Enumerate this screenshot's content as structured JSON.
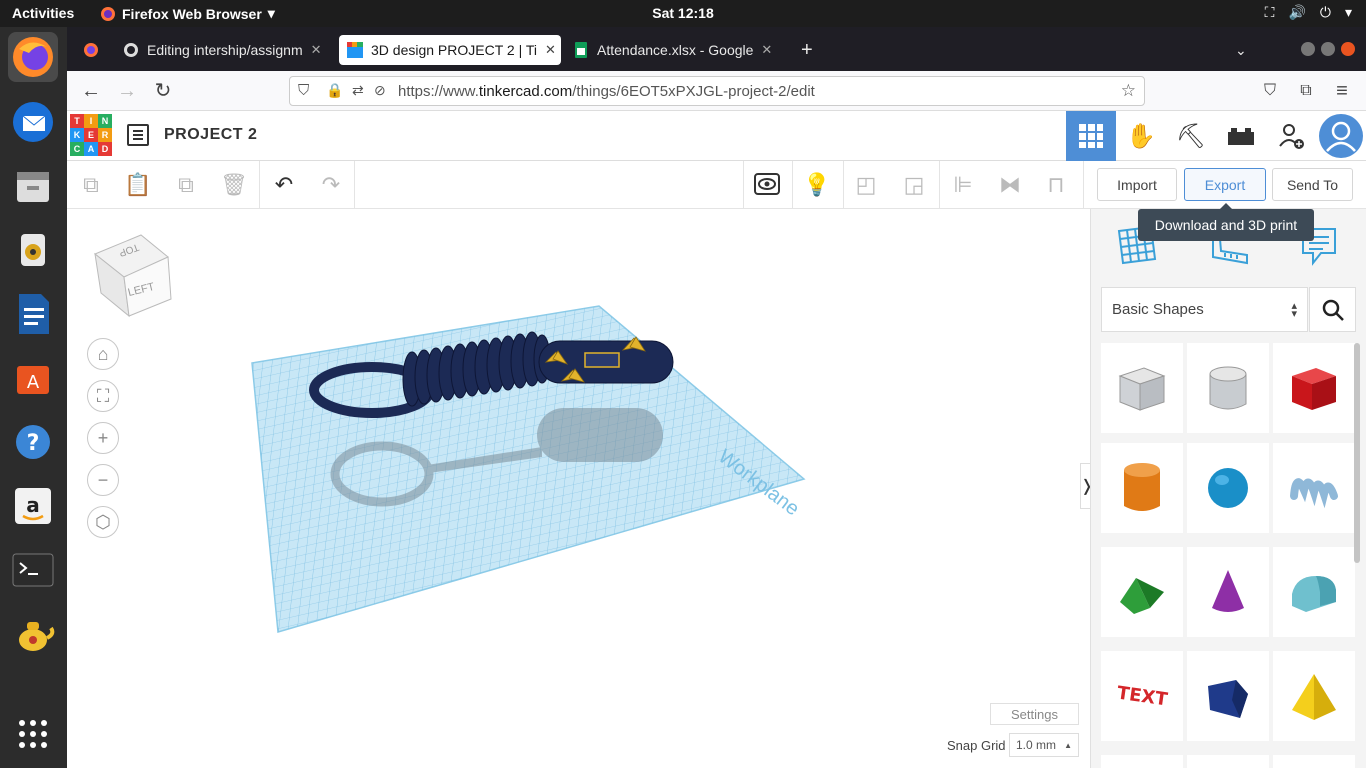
{
  "system": {
    "activities": "Activities",
    "app_name": "Firefox Web Browser",
    "clock": "Sat 12:18"
  },
  "browser": {
    "tabs": [
      {
        "title": "Editing intership/assignm",
        "icon": "github-icon"
      },
      {
        "title": "3D design PROJECT 2 | Ti",
        "icon": "tinkercad-icon",
        "selected": true
      },
      {
        "title": "Attendance.xlsx - Google",
        "icon": "sheets-icon"
      }
    ],
    "url_prefix": "https://www.",
    "url_domain": "tinkercad.com",
    "url_path": "/things/6EOT5xPXJGL-project-2/edit"
  },
  "tinkercad": {
    "logo_letters": [
      "T",
      "I",
      "N",
      "K",
      "E",
      "R",
      "C",
      "A",
      "D"
    ],
    "project_title": "PROJECT 2",
    "import_label": "Import",
    "export_label": "Export",
    "sendto_label": "Send To",
    "tooltip": "Download and 3D print",
    "shape_category": "Basic Shapes",
    "view_cube_top": "TOP",
    "view_cube_left": "LEFT",
    "workplane_label": "Workplane",
    "settings_label": "Settings",
    "snap_label": "Snap Grid",
    "snap_value": "1.0 mm",
    "text_shape_label": "TEXT"
  },
  "colors": {
    "accent": "#4e8ed6",
    "grid": "#9fd1ec",
    "model": "#1c2a55",
    "star": "#e2b32c"
  }
}
